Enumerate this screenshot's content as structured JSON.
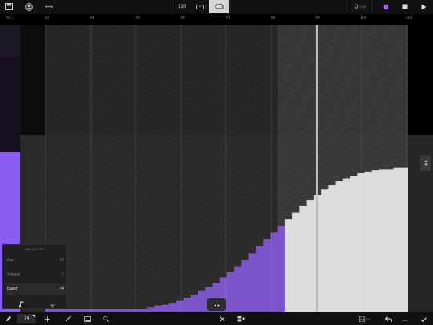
{
  "toolbar": {
    "tempo": "138",
    "quantize_label": "Q",
    "quantize_value": "1/16",
    "record_color": "#a259ff"
  },
  "ruler": {
    "position": "95.1",
    "bars": [
      "93",
      "94",
      "95",
      "96",
      "97",
      "98",
      "99",
      "100",
      "101"
    ]
  },
  "data_type_popup": {
    "title": "DATA TYPE",
    "options": [
      {
        "label": "Pan",
        "value": "10"
      },
      {
        "label": "Volume",
        "value": "7"
      },
      {
        "label": "Cutoff",
        "value": "74",
        "selected": true
      }
    ]
  },
  "bottom": {
    "value": "74",
    "grid_value": "1/8"
  },
  "automation": {
    "parameter": "Cutoff",
    "color": "#7b55c9",
    "selected_color": "#dcdcdc",
    "values": [
      0,
      0,
      0,
      0,
      0,
      0,
      0,
      0,
      0,
      0,
      0,
      0,
      0,
      0,
      1,
      2,
      3,
      4,
      6,
      8,
      10,
      13,
      16,
      19,
      23,
      27,
      31,
      36,
      41,
      46,
      51,
      56,
      61,
      66,
      71,
      76,
      80,
      84,
      88,
      91,
      94,
      96,
      98,
      100,
      101,
      102,
      103,
      103,
      104,
      104
    ]
  },
  "colors": {
    "accent": "#8b5cf0",
    "background": "#0c0c0c"
  }
}
